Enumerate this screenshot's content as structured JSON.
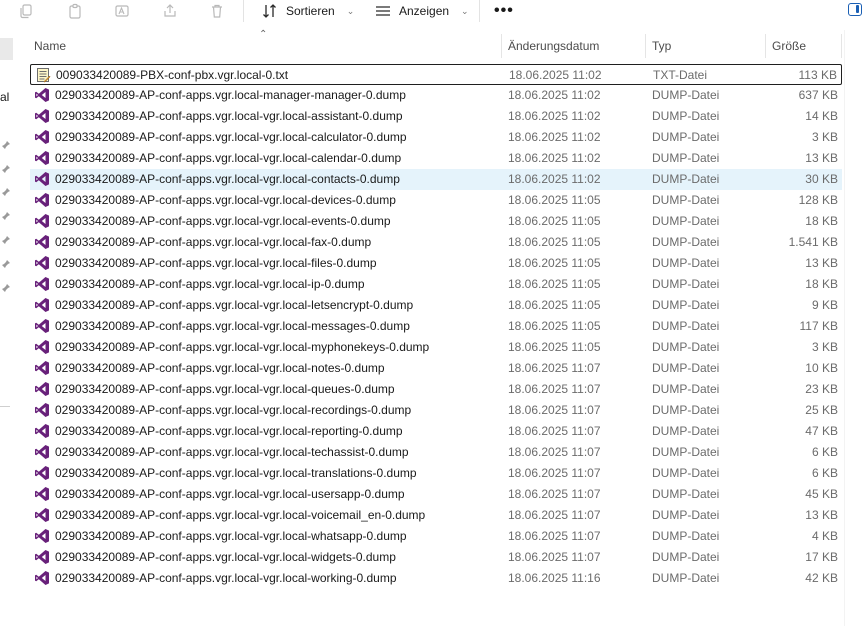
{
  "toolbar": {
    "sort_label": "Sortieren",
    "view_label": "Anzeigen",
    "more_label": "•••"
  },
  "nav": {
    "partial_label": "al"
  },
  "columns": {
    "name": "Name",
    "date": "Änderungsdatum",
    "type": "Typ",
    "size": "Größe"
  },
  "files": [
    {
      "name": "009033420089-PBX-conf-pbx.vgr.local-0.txt",
      "date": "18.06.2025 11:02",
      "type": "TXT-Datei",
      "size": "113 KB",
      "icon": "text-file-icon"
    },
    {
      "name": "029033420089-AP-conf-apps.vgr.local-manager-manager-0.dump",
      "date": "18.06.2025 11:02",
      "type": "DUMP-Datei",
      "size": "637 KB",
      "icon": "visual-studio-icon"
    },
    {
      "name": "029033420089-AP-conf-apps.vgr.local-vgr.local-assistant-0.dump",
      "date": "18.06.2025 11:02",
      "type": "DUMP-Datei",
      "size": "14 KB",
      "icon": "visual-studio-icon"
    },
    {
      "name": "029033420089-AP-conf-apps.vgr.local-vgr.local-calculator-0.dump",
      "date": "18.06.2025 11:02",
      "type": "DUMP-Datei",
      "size": "3 KB",
      "icon": "visual-studio-icon"
    },
    {
      "name": "029033420089-AP-conf-apps.vgr.local-vgr.local-calendar-0.dump",
      "date": "18.06.2025 11:02",
      "type": "DUMP-Datei",
      "size": "13 KB",
      "icon": "visual-studio-icon"
    },
    {
      "name": "029033420089-AP-conf-apps.vgr.local-vgr.local-contacts-0.dump",
      "date": "18.06.2025 11:02",
      "type": "DUMP-Datei",
      "size": "30 KB",
      "icon": "visual-studio-icon"
    },
    {
      "name": "029033420089-AP-conf-apps.vgr.local-vgr.local-devices-0.dump",
      "date": "18.06.2025 11:05",
      "type": "DUMP-Datei",
      "size": "128 KB",
      "icon": "visual-studio-icon"
    },
    {
      "name": "029033420089-AP-conf-apps.vgr.local-vgr.local-events-0.dump",
      "date": "18.06.2025 11:05",
      "type": "DUMP-Datei",
      "size": "18 KB",
      "icon": "visual-studio-icon"
    },
    {
      "name": "029033420089-AP-conf-apps.vgr.local-vgr.local-fax-0.dump",
      "date": "18.06.2025 11:05",
      "type": "DUMP-Datei",
      "size": "1.541 KB",
      "icon": "visual-studio-icon"
    },
    {
      "name": "029033420089-AP-conf-apps.vgr.local-vgr.local-files-0.dump",
      "date": "18.06.2025 11:05",
      "type": "DUMP-Datei",
      "size": "13 KB",
      "icon": "visual-studio-icon"
    },
    {
      "name": "029033420089-AP-conf-apps.vgr.local-vgr.local-ip-0.dump",
      "date": "18.06.2025 11:05",
      "type": "DUMP-Datei",
      "size": "18 KB",
      "icon": "visual-studio-icon"
    },
    {
      "name": "029033420089-AP-conf-apps.vgr.local-vgr.local-letsencrypt-0.dump",
      "date": "18.06.2025 11:05",
      "type": "DUMP-Datei",
      "size": "9 KB",
      "icon": "visual-studio-icon"
    },
    {
      "name": "029033420089-AP-conf-apps.vgr.local-vgr.local-messages-0.dump",
      "date": "18.06.2025 11:05",
      "type": "DUMP-Datei",
      "size": "117 KB",
      "icon": "visual-studio-icon"
    },
    {
      "name": "029033420089-AP-conf-apps.vgr.local-vgr.local-myphonekeys-0.dump",
      "date": "18.06.2025 11:05",
      "type": "DUMP-Datei",
      "size": "3 KB",
      "icon": "visual-studio-icon"
    },
    {
      "name": "029033420089-AP-conf-apps.vgr.local-vgr.local-notes-0.dump",
      "date": "18.06.2025 11:07",
      "type": "DUMP-Datei",
      "size": "10 KB",
      "icon": "visual-studio-icon"
    },
    {
      "name": "029033420089-AP-conf-apps.vgr.local-vgr.local-queues-0.dump",
      "date": "18.06.2025 11:07",
      "type": "DUMP-Datei",
      "size": "23 KB",
      "icon": "visual-studio-icon"
    },
    {
      "name": "029033420089-AP-conf-apps.vgr.local-vgr.local-recordings-0.dump",
      "date": "18.06.2025 11:07",
      "type": "DUMP-Datei",
      "size": "25 KB",
      "icon": "visual-studio-icon"
    },
    {
      "name": "029033420089-AP-conf-apps.vgr.local-vgr.local-reporting-0.dump",
      "date": "18.06.2025 11:07",
      "type": "DUMP-Datei",
      "size": "47 KB",
      "icon": "visual-studio-icon"
    },
    {
      "name": "029033420089-AP-conf-apps.vgr.local-vgr.local-techassist-0.dump",
      "date": "18.06.2025 11:07",
      "type": "DUMP-Datei",
      "size": "6 KB",
      "icon": "visual-studio-icon"
    },
    {
      "name": "029033420089-AP-conf-apps.vgr.local-vgr.local-translations-0.dump",
      "date": "18.06.2025 11:07",
      "type": "DUMP-Datei",
      "size": "6 KB",
      "icon": "visual-studio-icon"
    },
    {
      "name": "029033420089-AP-conf-apps.vgr.local-vgr.local-usersapp-0.dump",
      "date": "18.06.2025 11:07",
      "type": "DUMP-Datei",
      "size": "45 KB",
      "icon": "visual-studio-icon"
    },
    {
      "name": "029033420089-AP-conf-apps.vgr.local-vgr.local-voicemail_en-0.dump",
      "date": "18.06.2025 11:07",
      "type": "DUMP-Datei",
      "size": "13 KB",
      "icon": "visual-studio-icon"
    },
    {
      "name": "029033420089-AP-conf-apps.vgr.local-vgr.local-whatsapp-0.dump",
      "date": "18.06.2025 11:07",
      "type": "DUMP-Datei",
      "size": "4 KB",
      "icon": "visual-studio-icon"
    },
    {
      "name": "029033420089-AP-conf-apps.vgr.local-vgr.local-widgets-0.dump",
      "date": "18.06.2025 11:07",
      "type": "DUMP-Datei",
      "size": "17 KB",
      "icon": "visual-studio-icon"
    },
    {
      "name": "029033420089-AP-conf-apps.vgr.local-vgr.local-working-0.dump",
      "date": "18.06.2025 11:16",
      "type": "DUMP-Datei",
      "size": "42 KB",
      "icon": "visual-studio-icon"
    }
  ],
  "colors": {
    "accent": "#1a5fb4",
    "vs_purple": "#68217a",
    "hover_row": "#e5f3fb"
  }
}
